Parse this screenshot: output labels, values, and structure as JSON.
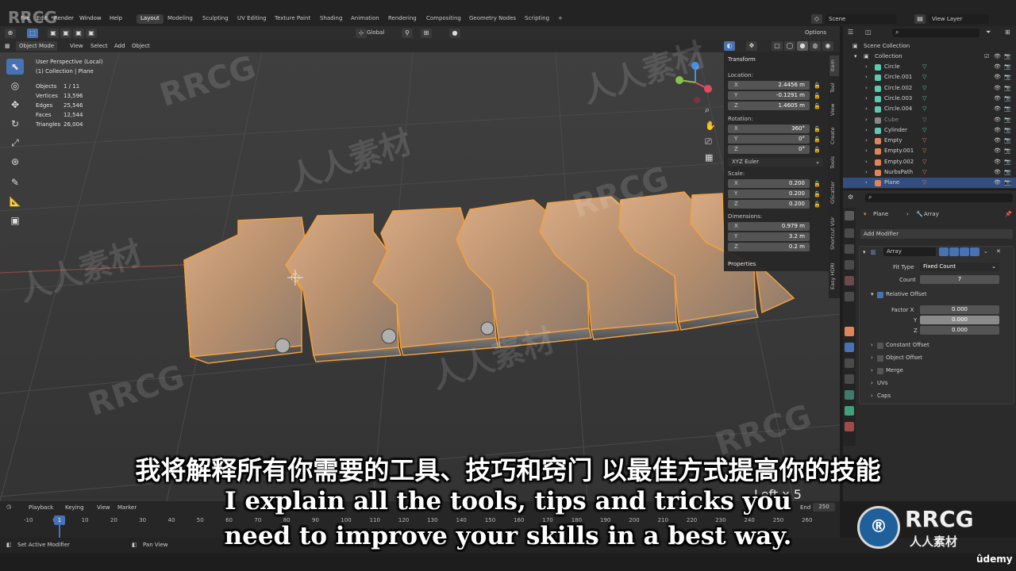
{
  "top_menu": [
    "File",
    "Edit",
    "Render",
    "Window",
    "Help"
  ],
  "workspaces": [
    "Layout",
    "Modeling",
    "Sculpting",
    "UV Editing",
    "Texture Paint",
    "Shading",
    "Animation",
    "Rendering",
    "Compositing",
    "Geometry Nodes",
    "Scripting"
  ],
  "active_workspace": "Layout",
  "add_workspace": "+",
  "scene": "Scene",
  "view_layer": "View Layer",
  "header": {
    "mode": "Object Mode",
    "menus": [
      "View",
      "Select",
      "Add",
      "Object"
    ],
    "orientation": "Global",
    "options": "Options"
  },
  "viewport": {
    "perspective": "User Perspective (Local)",
    "collection": "(1) Collection | Plane",
    "stats": [
      {
        "label": "Objects",
        "value": "1 / 11"
      },
      {
        "label": "Vertices",
        "value": "13,596"
      },
      {
        "label": "Edges",
        "value": "25,546"
      },
      {
        "label": "Faces",
        "value": "12,544"
      },
      {
        "label": "Triangles",
        "value": "26,004"
      }
    ],
    "overlay_text": "Left x 5"
  },
  "npanel": {
    "title": "Transform",
    "location_label": "Location:",
    "location": [
      {
        "axis": "X",
        "value": "2.4456 m"
      },
      {
        "axis": "Y",
        "value": "-0.1291 m"
      },
      {
        "axis": "Z",
        "value": "1.4605 m"
      }
    ],
    "rotation_label": "Rotation:",
    "rotation": [
      {
        "axis": "X",
        "value": "360°"
      },
      {
        "axis": "Y",
        "value": "0°"
      },
      {
        "axis": "Z",
        "value": "0°"
      }
    ],
    "rotation_mode": "XYZ Euler",
    "scale_label": "Scale:",
    "scale": [
      {
        "axis": "X",
        "value": "0.200"
      },
      {
        "axis": "Y",
        "value": "0.200"
      },
      {
        "axis": "Z",
        "value": "0.200"
      }
    ],
    "dimensions_label": "Dimensions:",
    "dimensions": [
      {
        "axis": "X",
        "value": "0.979 m"
      },
      {
        "axis": "Y",
        "value": "3.2 m"
      },
      {
        "axis": "Z",
        "value": "0.2 m"
      }
    ],
    "properties": "Properties",
    "tabs": [
      "Item",
      "Tool",
      "View",
      "Create",
      "Tools",
      "GScatter",
      "Shortcut VUr",
      "Easy HDRI"
    ]
  },
  "outliner": {
    "root": "Scene Collection",
    "collection": "Collection",
    "items": [
      {
        "name": "Circle",
        "color": "#5fc9b0",
        "selected": false,
        "dim": false
      },
      {
        "name": "Circle.001",
        "color": "#5fc9b0",
        "selected": false,
        "dim": false
      },
      {
        "name": "Circle.002",
        "color": "#5fc9b0",
        "selected": false,
        "dim": false
      },
      {
        "name": "Circle.003",
        "color": "#5fc9b0",
        "selected": false,
        "dim": false
      },
      {
        "name": "Circle.004",
        "color": "#5fc9b0",
        "selected": false,
        "dim": false
      },
      {
        "name": "Cube",
        "color": "#888888",
        "selected": false,
        "dim": true
      },
      {
        "name": "Cylinder",
        "color": "#5fc9b0",
        "selected": false,
        "dim": false
      },
      {
        "name": "Empty",
        "color": "#e0855a",
        "selected": false,
        "dim": false
      },
      {
        "name": "Empty.001",
        "color": "#e0855a",
        "selected": false,
        "dim": false
      },
      {
        "name": "Empty.002",
        "color": "#e0855a",
        "selected": false,
        "dim": false
      },
      {
        "name": "NurbsPath",
        "color": "#e0855a",
        "selected": false,
        "dim": false
      },
      {
        "name": "Plane",
        "color": "#e0855a",
        "selected": true,
        "dim": false
      }
    ]
  },
  "properties": {
    "object": "Plane",
    "modifier_tab": "Array",
    "add_modifier": "Add Modifier",
    "modifier_name": "Array",
    "fit_type_label": "Fit Type",
    "fit_type": "Fixed Count",
    "count_label": "Count",
    "count": "7",
    "relative_offset": "Relative Offset",
    "factor_x_label": "Factor X",
    "factor_x": "0.000",
    "factor_y_label": "Y",
    "factor_y": "0.000",
    "factor_z_label": "Z",
    "factor_z": "0.000",
    "constant_offset": "Constant Offset",
    "object_offset": "Object Offset",
    "merge": "Merge",
    "uvs": "UVs",
    "caps": "Caps"
  },
  "timeline": {
    "menus": [
      "Playback",
      "Keying",
      "View",
      "Marker"
    ],
    "current_frame": "1",
    "ticks": [
      "-10",
      "0",
      "10",
      "20",
      "30",
      "40",
      "50",
      "60",
      "70",
      "80",
      "90",
      "100",
      "110",
      "120",
      "130",
      "140",
      "150",
      "160",
      "170",
      "180",
      "190",
      "200",
      "210",
      "220",
      "230",
      "240",
      "250",
      "260"
    ],
    "end_label": "End",
    "end_value": "250"
  },
  "status": {
    "left": "Set Active Modifier",
    "middle": "Pan View"
  },
  "subtitles": {
    "chinese": "我将解释所有你需要的工具、技巧和窍门 以最佳方式提高你的技能",
    "english_line1": "I explain all the tools, tips and tricks you",
    "english_line2": "need to improve your skills in a best way."
  },
  "watermarks": {
    "brand": "RRCG",
    "brand_cn": "人人素材",
    "udemy": "ûdemy"
  },
  "colors": {
    "accent": "#4772b3",
    "selection_outline": "#f0a040"
  }
}
